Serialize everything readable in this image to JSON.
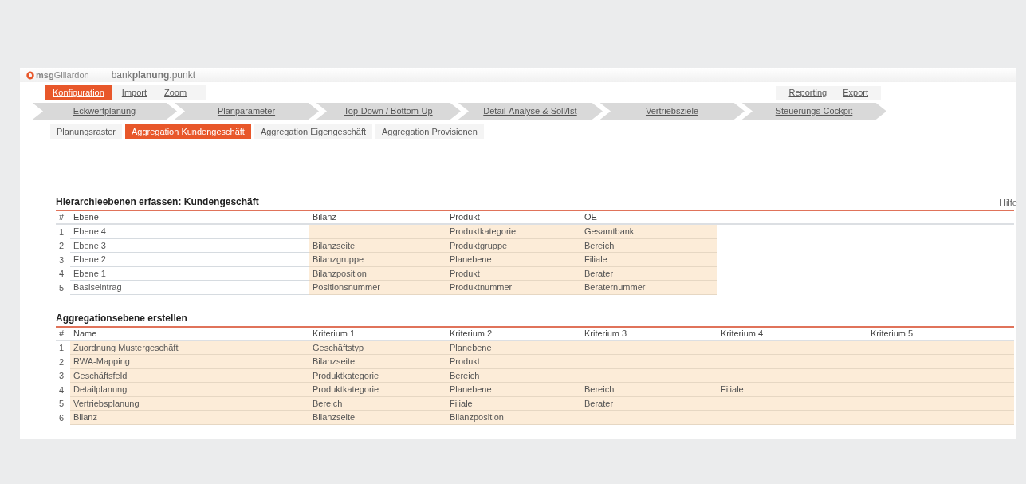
{
  "header": {
    "company": "**msg**Gillardon",
    "product": "bank**planung**.punkt"
  },
  "menu": [
    {
      "label": "Konfiguration",
      "selected": true
    },
    {
      "label": "Import",
      "selected": false
    },
    {
      "label": "Zoom",
      "selected": false
    }
  ],
  "menu_right": [
    "Reporting",
    "Export"
  ],
  "process_steps": [
    {
      "label": "Eckwertplanung",
      "selected": false
    },
    {
      "label": "Planparameter",
      "selected": false
    },
    {
      "label": "Top-Down / Bottom-Up",
      "selected": false
    },
    {
      "label": "Detail-Analyse  & Soll/Ist",
      "selected": false
    },
    {
      "label": "Vertriebsziele",
      "selected": false
    },
    {
      "label": "Steuerungs-Cockpit",
      "selected": false
    }
  ],
  "subtabs": [
    {
      "label": "Planungsraster",
      "selected": false
    },
    {
      "label": "Aggregation Kundengeschäft",
      "selected": true
    },
    {
      "label": "Aggregation Eigengeschäft",
      "selected": false
    },
    {
      "label": "Aggregation Provisionen",
      "selected": false
    }
  ],
  "tables": [
    {
      "title": "Hierarchieebenen erfassen: Kundengeschäft",
      "help": "Hilfe",
      "columns": [
        {
          "label": "#",
          "kind": "index"
        },
        {
          "label": "Ebene",
          "kind": "label"
        },
        {
          "label": "Bilanz",
          "kind": "input"
        },
        {
          "label": "Produkt",
          "kind": "input"
        },
        {
          "label": "OE",
          "kind": "input"
        }
      ],
      "rows": [
        [
          "1",
          "Ebene 4",
          null,
          "Produktkategorie",
          "Gesamtbank"
        ],
        [
          "2",
          "Ebene 3",
          "Bilanzseite",
          "Produktgruppe",
          "Bereich"
        ],
        [
          "3",
          "Ebene 2",
          "Bilanzgruppe",
          "Planebene",
          "Filiale"
        ],
        [
          "4",
          "Ebene 1",
          "Bilanzposition",
          "Produkt",
          "Berater"
        ],
        [
          "5",
          "Basiseintrag",
          "Positionsnummer",
          "Produktnummer",
          "Beraternummer"
        ]
      ]
    },
    {
      "title": "Aggregationsebene erstellen",
      "columns": [
        {
          "label": "#",
          "kind": "index"
        },
        {
          "label": "Name",
          "kind": "input"
        },
        {
          "label": "Kriterium 1",
          "kind": "input"
        },
        {
          "label": "Kriterium 2",
          "kind": "input"
        },
        {
          "label": "Kriterium 3",
          "kind": "input"
        },
        {
          "label": "Kriterium 4",
          "kind": "input"
        },
        {
          "label": "Kriterium 5",
          "kind": "input"
        }
      ],
      "rows": [
        [
          "1",
          "Zuordnung Mustergeschäft",
          "Geschäftstyp",
          "Planebene"
        ],
        [
          "2",
          "RWA-Mapping",
          "Bilanzseite",
          "Produkt"
        ],
        [
          "3",
          "Geschäftsfeld",
          "Produktkategorie",
          "Bereich"
        ],
        [
          "4",
          "Detailplanung",
          "Produktkategorie",
          "Planebene",
          "Bereich",
          "Filiale"
        ],
        [
          "5",
          "Vertriebsplanung",
          "Bereich",
          "Filiale",
          "Berater"
        ],
        [
          "6",
          "Bilanz",
          "Bilanzseite",
          "Bilanzposition"
        ]
      ]
    }
  ]
}
